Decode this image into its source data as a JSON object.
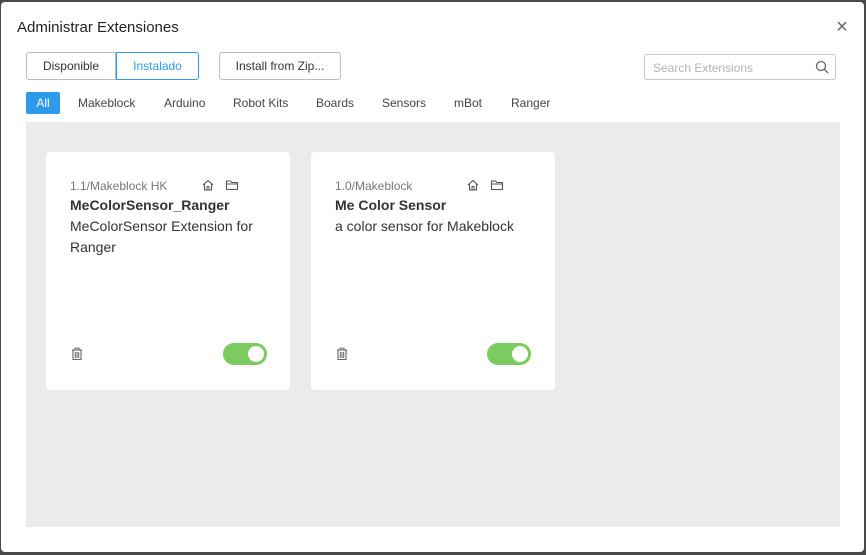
{
  "dialog": {
    "title": "Administrar Extensiones",
    "close_label": "×"
  },
  "toolbar": {
    "tab_available": "Disponible",
    "tab_installed": "Instalado",
    "install_zip": "Install from Zip...",
    "search_placeholder": "Search Extensions",
    "search_value": ""
  },
  "categories": [
    {
      "label": "All",
      "active": true
    },
    {
      "label": "Makeblock",
      "active": false
    },
    {
      "label": "Arduino",
      "active": false
    },
    {
      "label": "Robot Kits",
      "active": false
    },
    {
      "label": "Boards",
      "active": false
    },
    {
      "label": "Sensors",
      "active": false
    },
    {
      "label": "mBot",
      "active": false
    },
    {
      "label": "Ranger",
      "active": false
    }
  ],
  "extensions": [
    {
      "version": "1.1/Makeblock HK",
      "name": "MeColorSensor_Ranger",
      "description": "MeColorSensor Extension for Ranger",
      "enabled": true
    },
    {
      "version": "1.0/Makeblock",
      "name": "Me Color Sensor",
      "description": "a color sensor for Makeblock",
      "enabled": true
    }
  ],
  "colors": {
    "accent": "#2e9bea",
    "toggle_on": "#7ccb5e",
    "content_bg": "#ebebeb"
  }
}
